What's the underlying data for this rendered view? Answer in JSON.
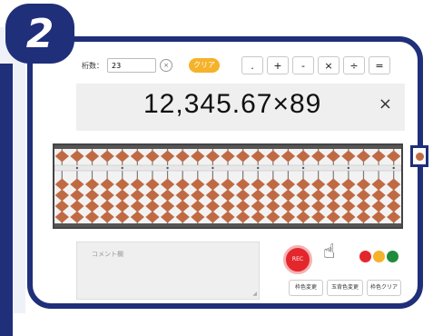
{
  "step_badge": "2",
  "toolbar": {
    "digits_label": "桁数：",
    "digits_value": "23",
    "spin_symbol": "×",
    "clear_label": "クリア",
    "operators": [
      ".",
      "+",
      "-",
      "×",
      "÷",
      "="
    ]
  },
  "display": {
    "expression": "12,345.67×89",
    "close_symbol": "×"
  },
  "abacus": {
    "rods": 23,
    "bead_color": "#c06a44",
    "frame_color": "#555555",
    "bar_color": "#e8e8e8"
  },
  "comment": {
    "placeholder": "コメント欄"
  },
  "recorder": {
    "rec_label": "REC",
    "color_dots": [
      "#e4272c",
      "#f5b22a",
      "#1e8c3a"
    ]
  },
  "settings_buttons": [
    "枠色変更",
    "玉背色変更",
    "枠色クリア"
  ],
  "colors": {
    "accent": "#1f2f7a",
    "clear_button": "#f5b22a"
  }
}
